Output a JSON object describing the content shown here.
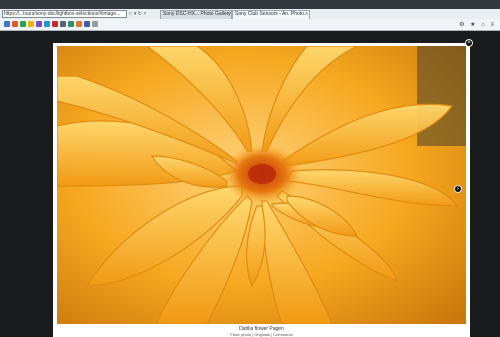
{
  "browser": {
    "address_url": "https://...tours/sony-dsc/lightbox-selections/#image...",
    "address_icons": "☆ ▾ ↻ ×",
    "tabs": [
      {
        "label": "Sony DSC-HX... Photo Gallery"
      },
      {
        "label": "Sony Club Sensors - An. Photo..."
      }
    ],
    "toolbar_right": "⚙ ★ ⌂ ≡"
  },
  "lightbox": {
    "caption_title": "Dahlia flower Pagen",
    "caption_links": "Flickr photo | Originals | Comments"
  },
  "colors": {
    "accent": "#f3a51c",
    "overlay": "#1a1b1d"
  }
}
